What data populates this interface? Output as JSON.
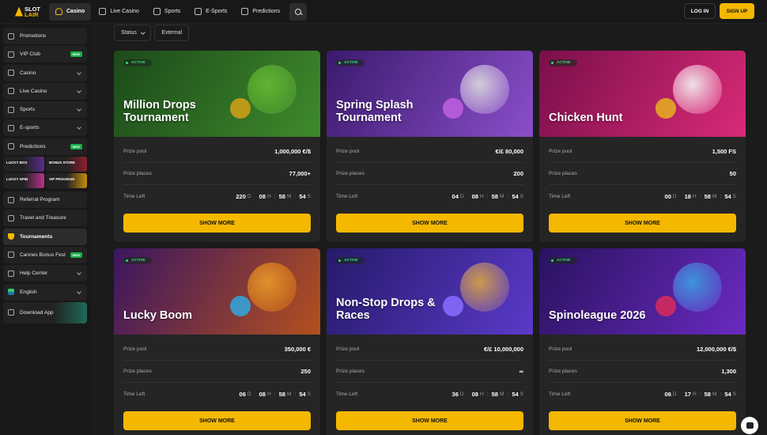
{
  "brand": {
    "line1": "SLOT",
    "line2": "LAIR"
  },
  "nav": [
    {
      "label": "Casino",
      "icon": "casino-icon",
      "active": true
    },
    {
      "label": "Live Casino",
      "icon": "live-casino-icon"
    },
    {
      "label": "Sports",
      "icon": "sports-icon"
    },
    {
      "label": "E-Sports",
      "icon": "esports-icon"
    },
    {
      "label": "Predictions",
      "icon": "predictions-icon"
    }
  ],
  "auth": {
    "login": "LOG IN",
    "signup": "SIGN UP"
  },
  "sidebar": {
    "items_top": [
      {
        "label": "Promotions",
        "icon": "gift-icon"
      },
      {
        "label": "VIP Club",
        "icon": "crown-icon",
        "badge": "NEW"
      },
      {
        "label": "Casino",
        "icon": "casino-icon",
        "chevron": true
      },
      {
        "label": "Live Casino",
        "icon": "live-casino-icon",
        "chevron": true
      },
      {
        "label": "Sports",
        "icon": "sports-icon",
        "chevron": true
      },
      {
        "label": "E-sports",
        "icon": "esports-icon",
        "chevron": true
      },
      {
        "label": "Predictions",
        "icon": "predictions-icon",
        "badge": "NEW"
      }
    ],
    "promo_tiles": [
      "LUCKY BOX",
      "BONUS STORE",
      "LUCKY SPIN",
      "VIP PROGRAM"
    ],
    "items_bottom": [
      {
        "label": "Referral Program",
        "icon": "referral-icon"
      },
      {
        "label": "Travel and Treasure",
        "icon": "treasure-icon"
      },
      {
        "label": "Tournaments",
        "icon": "trophy-icon",
        "active": true
      },
      {
        "label": "Cannes Bonus Fest",
        "icon": "festival-icon",
        "badge": "NEW"
      },
      {
        "label": "Help Center",
        "icon": "help-icon",
        "chevron": true
      },
      {
        "label": "English",
        "icon": "flag-icon",
        "chevron": true
      }
    ],
    "download": "Download App"
  },
  "filters": {
    "status": "Status",
    "external": "External"
  },
  "labels": {
    "active": "ACTIVE",
    "prize_pool": "Prize pool",
    "prize_places": "Prize places",
    "time_left": "Time Left",
    "show_more": "SHOW MORE",
    "d": "D",
    "h": "H",
    "m": "M",
    "s": "S"
  },
  "tournaments": [
    {
      "title": "Million Drops Tournament",
      "pool": "1,000,000 €/$",
      "places": "77,000+",
      "d": "220",
      "h": "08",
      "m": "58",
      "s": "54",
      "bg": [
        "#1c4a1a",
        "#3f8a2c"
      ],
      "art": "#6b3",
      "art2": "#d4a017"
    },
    {
      "title": "Spring Splash Tournament",
      "pool": "€/£ 80,000",
      "places": "200",
      "d": "04",
      "h": "08",
      "m": "58",
      "s": "54",
      "bg": [
        "#3b1a6e",
        "#8a4ec9"
      ],
      "art": "#ddd",
      "art2": "#c060e0"
    },
    {
      "title": "Chicken Hunt",
      "pool": "1,500 FS",
      "places": "50",
      "d": "00",
      "h": "18",
      "m": "58",
      "s": "54",
      "bg": [
        "#7a0f4a",
        "#d92a77"
      ],
      "art": "#f4f4f4",
      "art2": "#e8b020"
    },
    {
      "title": "Lucky Boom",
      "pool": "350,000 €",
      "places": "250",
      "d": "06",
      "h": "08",
      "m": "58",
      "s": "54",
      "bg": [
        "#3a1660",
        "#b4501e"
      ],
      "art": "#e89a2a",
      "art2": "#2fa8e0"
    },
    {
      "title": "Non-Stop Drops & Races",
      "pool": "€/£ 10,000,000",
      "places": "∞",
      "d": "36",
      "h": "08",
      "m": "58",
      "s": "54",
      "bg": [
        "#261a6a",
        "#5a3ac9"
      ],
      "art": "#d9a640",
      "art2": "#8a6cff"
    },
    {
      "title": "Spinoleague 2026",
      "pool": "12,000,000 €/$",
      "places": "1,300",
      "d": "06",
      "h": "17",
      "m": "58",
      "s": "54",
      "bg": [
        "#2a1260",
        "#6a2ac0"
      ],
      "art": "#3aa0e0",
      "art2": "#d92a5a"
    }
  ]
}
